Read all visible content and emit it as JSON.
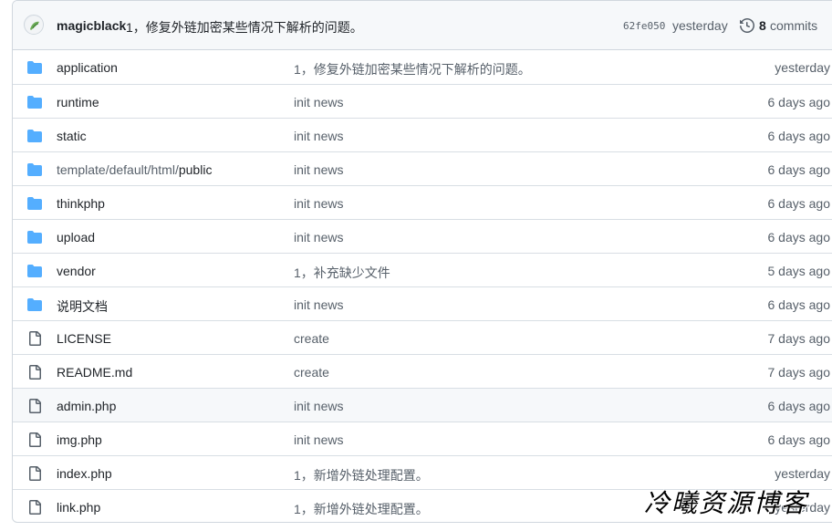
{
  "header": {
    "author": "magicblack",
    "message": "1，修复外链加密某些情况下解析的问题。",
    "sha": "62fe050",
    "when": "yesterday",
    "commits_count": "8",
    "commits_label": "commits"
  },
  "rows": [
    {
      "type": "folder",
      "prefix": "",
      "name": "application",
      "message": "1，修复外链加密某些情况下解析的问题。",
      "age": "yesterday"
    },
    {
      "type": "folder",
      "prefix": "",
      "name": "runtime",
      "message": "init news",
      "age": "6 days ago"
    },
    {
      "type": "folder",
      "prefix": "",
      "name": "static",
      "message": "init news",
      "age": "6 days ago"
    },
    {
      "type": "folder",
      "prefix": "template/default/html/",
      "name": "public",
      "message": "init news",
      "age": "6 days ago"
    },
    {
      "type": "folder",
      "prefix": "",
      "name": "thinkphp",
      "message": "init news",
      "age": "6 days ago"
    },
    {
      "type": "folder",
      "prefix": "",
      "name": "upload",
      "message": "init news",
      "age": "6 days ago"
    },
    {
      "type": "folder",
      "prefix": "",
      "name": "vendor",
      "message": "1，补充缺少文件",
      "age": "5 days ago"
    },
    {
      "type": "folder",
      "prefix": "",
      "name": "说明文档",
      "message": "init news",
      "age": "6 days ago"
    },
    {
      "type": "file",
      "prefix": "",
      "name": "LICENSE",
      "message": "create",
      "age": "7 days ago"
    },
    {
      "type": "file",
      "prefix": "",
      "name": "README.md",
      "message": "create",
      "age": "7 days ago"
    },
    {
      "type": "file",
      "prefix": "",
      "name": "admin.php",
      "message": "init news",
      "age": "6 days ago"
    },
    {
      "type": "file",
      "prefix": "",
      "name": "img.php",
      "message": "init news",
      "age": "6 days ago"
    },
    {
      "type": "file",
      "prefix": "",
      "name": "index.php",
      "message": "1，新增外链处理配置。",
      "age": "yesterday"
    },
    {
      "type": "file",
      "prefix": "",
      "name": "link.php",
      "message": "1，新增外链处理配置。",
      "age": "yesterday"
    }
  ],
  "watermark": "冷曦资源博客",
  "icons": {
    "folder": "folder-icon",
    "file": "file-icon",
    "history": "history-icon"
  },
  "colors": {
    "folder": "#54aeff",
    "file_icon": "#57606a",
    "muted": "#57606a",
    "border": "#d0d7de",
    "header_bg": "#f6f8fa"
  }
}
